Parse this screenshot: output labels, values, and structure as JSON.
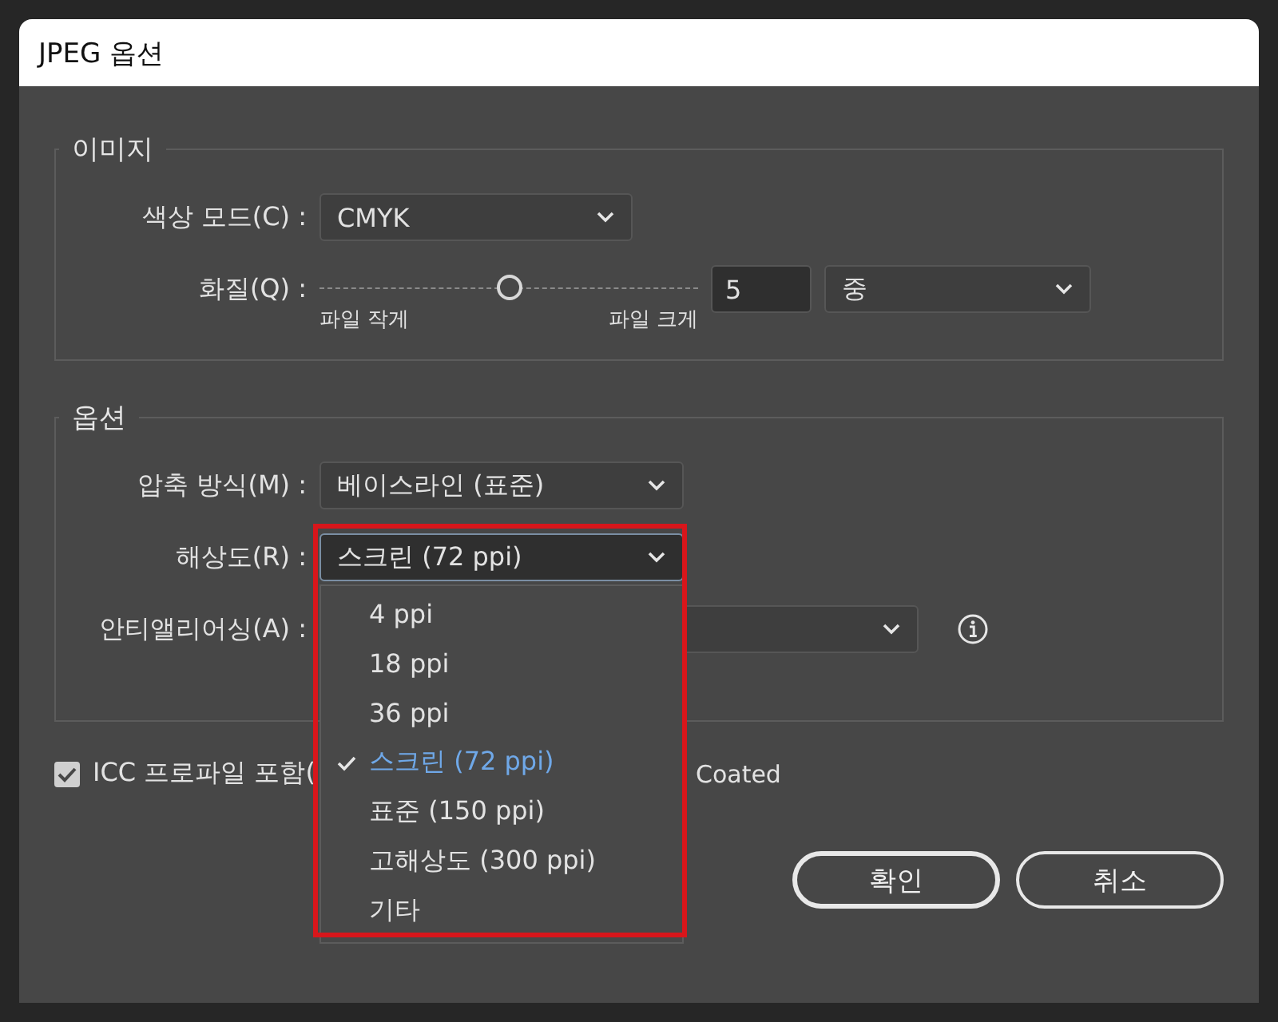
{
  "window": {
    "title": "JPEG 옵션"
  },
  "sections": [
    {
      "legend": "이미지",
      "rows": [
        {
          "kind": "dropdown",
          "label": "색상 모드(C) :",
          "value": "CMYK"
        },
        {
          "kind": "quality",
          "label": "화질(Q) :",
          "level": 0.5,
          "min_label": "파일 작게",
          "max_label": "파일 크게",
          "value": "5",
          "preset": "중"
        }
      ]
    },
    {
      "legend": "옵션",
      "rows": [
        {
          "kind": "dropdown",
          "label": "압축 방식(M) :",
          "value": "베이스라인 (표준)"
        },
        {
          "kind": "dropdown",
          "label": "해상도(R) :",
          "value": "스크린 (72 ppi)",
          "expanded": true,
          "options": [
            {
              "label": "4 ppi",
              "selected": false
            },
            {
              "label": "18 ppi",
              "selected": false
            },
            {
              "label": "36 ppi",
              "selected": false
            },
            {
              "label": "스크린 (72 ppi)",
              "selected": true
            },
            {
              "label": "표준 (150 ppi)",
              "selected": false
            },
            {
              "label": "고해상도 (300 ppi)",
              "selected": false
            },
            {
              "label": "기타",
              "selected": false
            }
          ]
        },
        {
          "kind": "dropdown",
          "label": "안티앨리어싱(A) :",
          "info": true
        }
      ]
    }
  ],
  "icc": {
    "checked": true,
    "label": "ICC 프로파일 포함(",
    "profile": "Coated"
  },
  "buttons": [
    {
      "label": "확인",
      "default": true
    },
    {
      "label": "취소",
      "default": false
    }
  ],
  "highlight": true
}
